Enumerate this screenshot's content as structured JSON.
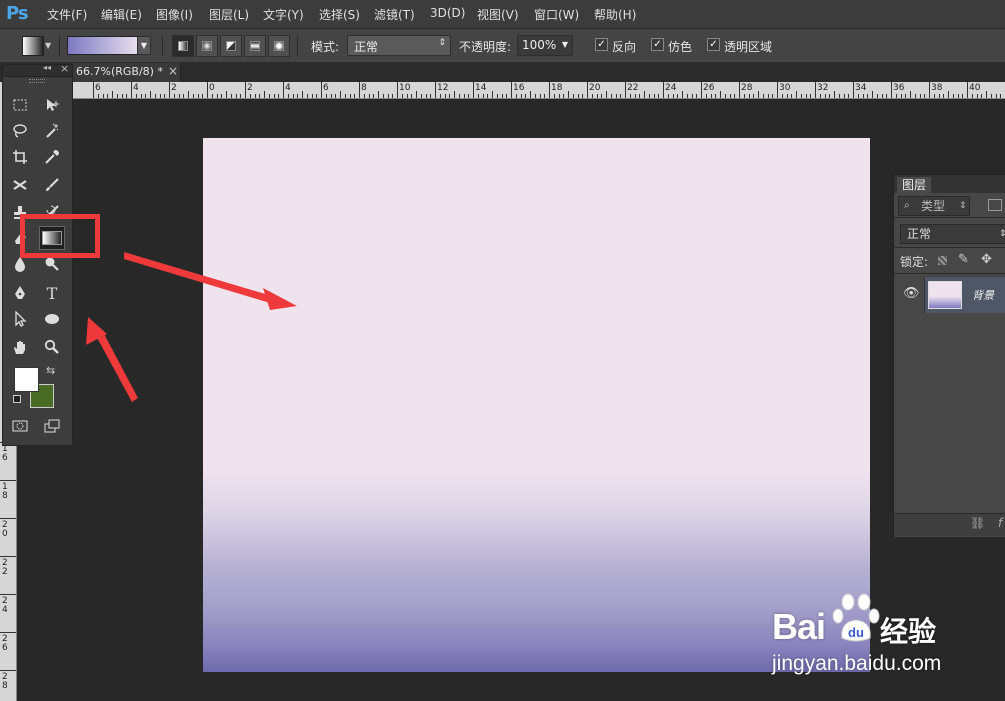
{
  "app": {
    "logo": "Ps"
  },
  "menu": {
    "items": [
      "文件(F)",
      "编辑(E)",
      "图像(I)",
      "图层(L)",
      "文字(Y)",
      "选择(S)",
      "滤镜(T)",
      "3D(D)",
      "视图(V)",
      "窗口(W)",
      "帮助(H)"
    ]
  },
  "options": {
    "mode_label": "模式:",
    "mode_value": "正常",
    "opacity_label": "不透明度:",
    "opacity_value": "100%",
    "reverse_label": "反向",
    "dither_label": "仿色",
    "transparency_label": "透明区域",
    "gradient_colors": [
      "#7d79c2",
      "#e8e0ee"
    ]
  },
  "document": {
    "tab_title": "66.7%(RGB/8) *",
    "close_glyph": "×"
  },
  "ruler": {
    "h_labels": [
      "6",
      "4",
      "2",
      "0",
      "2",
      "4",
      "6",
      "8",
      "10",
      "12",
      "14",
      "16",
      "18",
      "20",
      "22",
      "24",
      "26",
      "28",
      "30",
      "32",
      "34",
      "36",
      "38",
      "40"
    ],
    "v_labels": [
      "16",
      "18",
      "20",
      "22",
      "24",
      "26",
      "28"
    ]
  },
  "toolbox": {
    "collapse_glyph": "◂◂",
    "close_glyph": "×",
    "foreground_color": "#ffffff",
    "background_color": "#4a6b23"
  },
  "layers": {
    "tab_label": "图层",
    "filter_label": "类型",
    "blend_mode": "正常",
    "lock_label": "锁定:",
    "layer_name": "背景"
  },
  "watermark": {
    "brand_left": "Bai",
    "brand_right": "经验",
    "url": "jingyan.baidu.com"
  },
  "colors": {
    "accent_red": "#ee3a3a",
    "ps_blue": "#4ba7e8"
  }
}
